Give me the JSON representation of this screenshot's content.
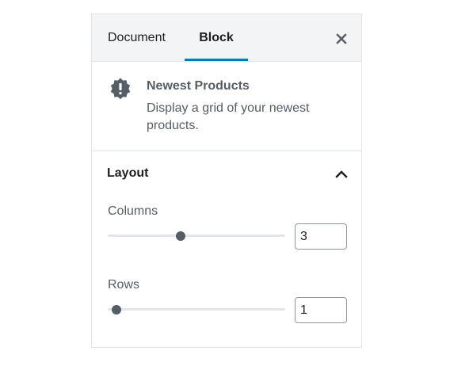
{
  "tabs": {
    "document_label": "Document",
    "block_label": "Block",
    "active": "Block",
    "accent_color": "#007cba"
  },
  "close": {
    "icon": "close-icon"
  },
  "block": {
    "icon": "warning-badge-icon",
    "title": "Newest Products",
    "description": "Display a grid of your newest products."
  },
  "layout": {
    "title": "Layout",
    "expanded": true,
    "columns": {
      "label": "Columns",
      "value": "3",
      "min": 1,
      "max": 6
    },
    "rows": {
      "label": "Rows",
      "value": "1",
      "min": 1,
      "max": 10
    }
  }
}
